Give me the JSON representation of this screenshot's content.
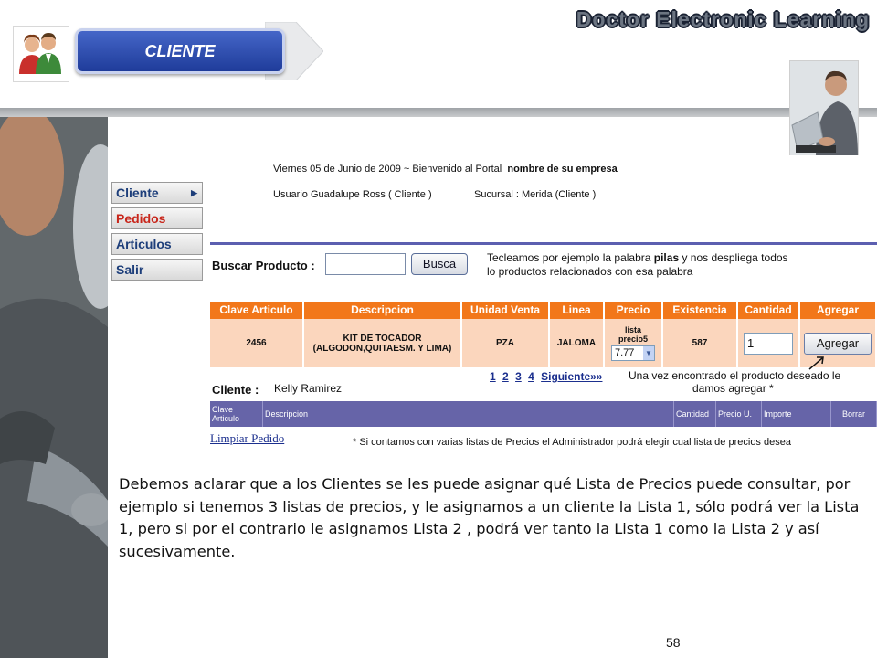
{
  "header": {
    "section_label": "CLIENTE",
    "brand_title": "Doctor Electronic Learning"
  },
  "app": {
    "welcome_prefix": "Viernes 05 de Junio de 2009 ~ Bienvenido al Portal",
    "company": "nombre de su empresa",
    "user": "Usuario Guadalupe Ross ( Cliente )",
    "branch": "Sucursal : Merida (Cliente )",
    "menu": [
      {
        "label": "Cliente",
        "arrow": "▶"
      },
      {
        "label": "Pedidos"
      },
      {
        "label": "Articulos"
      },
      {
        "label": "Salir"
      }
    ],
    "search": {
      "label": "Buscar Producto :",
      "value": "",
      "button": "Busca",
      "hint_line1_pre": "Tecleamos por ejemplo la palabra ",
      "hint_keyword": "pilas",
      "hint_line1_post": " y nos despliega todos",
      "hint_line2": "lo productos relacionados con esa palabra"
    },
    "product_table": {
      "headers": [
        "Clave Articulo",
        "Descripcion",
        "Unidad Venta",
        "Linea",
        "Precio",
        "Existencia",
        "Cantidad",
        "Agregar"
      ],
      "row": {
        "clave": "2456",
        "descripcion_l1": "KIT DE TOCADOR",
        "descripcion_l2": "(ALGODON,QUITAESM. Y LIMA)",
        "unidad": "PZA",
        "linea": "JALOMA",
        "precio_label_l1": "lista",
        "precio_label_l2": "precio5",
        "precio_value": "7.77",
        "existencia": "587",
        "cantidad": "1",
        "agregar_button": "Agregar"
      }
    },
    "pager": {
      "pages": [
        "1",
        "2",
        "3",
        "4"
      ],
      "next": "Siguiente»»"
    },
    "found_note_l1": "Una vez encontrado el producto deseado le",
    "found_note_l2": "damos agregar *",
    "client": {
      "label": "Cliente :",
      "name": "Kelly Ramirez"
    },
    "order_table": {
      "headers": [
        "Clave Articulo",
        "Descripcion",
        "Cantidad",
        "Precio U.",
        "Importe",
        "Borrar"
      ]
    },
    "clear_link": "Limpiar Pedido",
    "admin_note": "* Si contamos con varias listas de Precios el Administrador podrá elegir cual lista de precios desea"
  },
  "body_text": "Debemos aclarar que a los Clientes se les puede asignar qué Lista de Precios puede consultar, por ejemplo  si tenemos 3 listas de precios, y le asignamos a un cliente la Lista 1,  sólo podrá ver la Lista 1, pero si por el contrario le asignamos Lista 2 , podrá ver tanto la Lista 1 como la Lista 2 y así sucesivamente.",
  "page_number": "58",
  "colors": {
    "accent_blue": "#2a4aa8",
    "table_orange": "#f2771a",
    "row_peach": "#fbd6bd",
    "order_purple": "#6664a8"
  }
}
